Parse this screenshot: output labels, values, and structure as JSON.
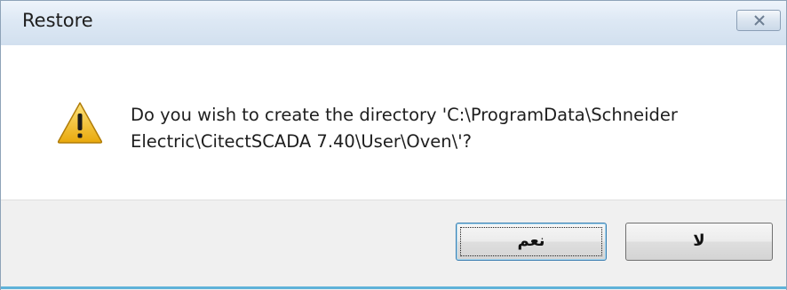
{
  "window": {
    "title": "Restore",
    "close_icon": "close-icon"
  },
  "message": {
    "icon": "warning-icon",
    "line1": "Do you wish to create the directory 'C:\\ProgramData\\Schneider",
    "line2": "Electric\\CitectSCADA 7.40\\User\\Oven\\'?"
  },
  "buttons": {
    "yes_label": "نعم",
    "no_label": "لا"
  },
  "colors": {
    "titlebar": "#dde8f4",
    "button_bar": "#f0f0f0",
    "warning_yellow": "#f5c518",
    "accent_edge": "#5fb2d9"
  }
}
